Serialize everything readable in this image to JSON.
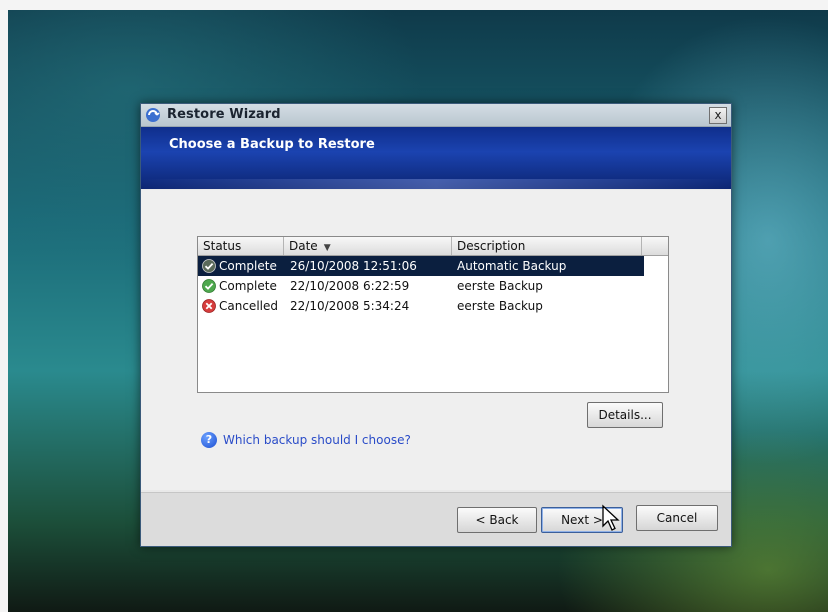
{
  "window": {
    "title": "Restore Wizard",
    "close_glyph": "x",
    "app_icon": "restore-wizard-icon"
  },
  "header": {
    "title": "Choose a Backup to Restore"
  },
  "table": {
    "columns": [
      {
        "label": "Status"
      },
      {
        "label": "Date"
      },
      {
        "label": "Description"
      }
    ],
    "sort_indicator": "▼",
    "rows": [
      {
        "status": "Complete",
        "status_icon": "check-icon",
        "date": "26/10/2008 12:51:06",
        "description": "Automatic Backup",
        "selected": true
      },
      {
        "status": "Complete",
        "status_icon": "check-icon",
        "date": "22/10/2008 6:22:59",
        "description": "eerste Backup",
        "selected": false
      },
      {
        "status": "Cancelled",
        "status_icon": "cancel-icon",
        "date": "22/10/2008 5:34:24",
        "description": "eerste Backup",
        "selected": false
      }
    ]
  },
  "details_button": "Details...",
  "help": {
    "text": "Which backup should I choose?",
    "icon": "help-icon",
    "glyph": "?"
  },
  "footer": {
    "back": "< Back",
    "next": "Next >",
    "cancel": "Cancel"
  },
  "colors": {
    "header_blue": "#1b43b0",
    "selection": "#0b1f3f",
    "link": "#2a4cc8"
  }
}
